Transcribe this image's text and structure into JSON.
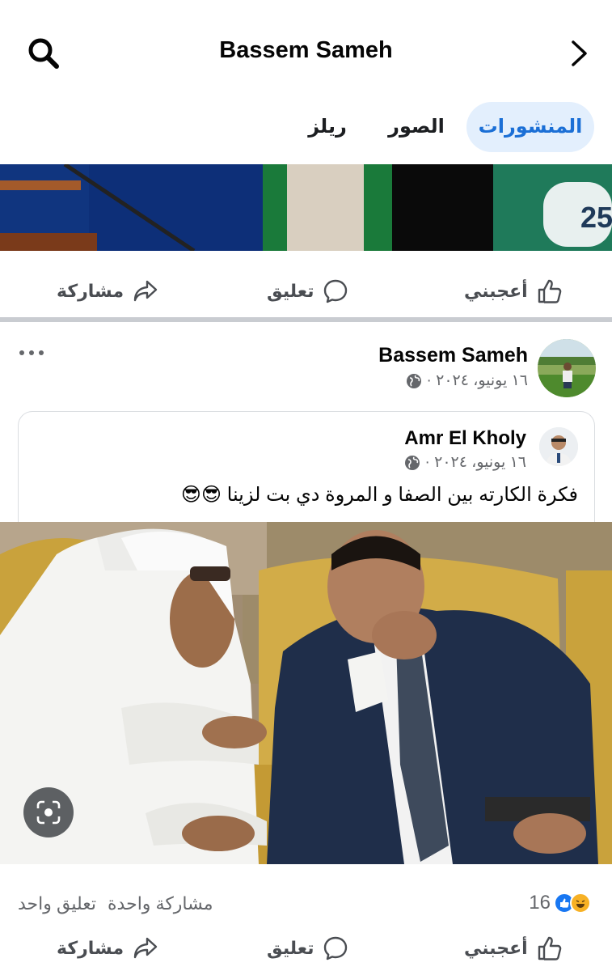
{
  "header": {
    "title": "Bassem Sameh",
    "search_icon": "search-icon",
    "back_icon": "chevron-right-icon"
  },
  "tabs": [
    {
      "label": "المنشورات",
      "active": true
    },
    {
      "label": "الصور",
      "active": false
    },
    {
      "label": "ريلز",
      "active": false
    }
  ],
  "actions": {
    "like": "أعجبني",
    "comment": "تعليق",
    "share": "مشاركة"
  },
  "post": {
    "author": "Bassem Sameh",
    "date": "١٦ يونيو، ٢٠٢٤ ·",
    "privacy_icon": "globe-icon",
    "shared": {
      "author": "Amr El Kholy",
      "date": "١٦ يونيو، ٢٠٢٤ ·",
      "text": "فكرة الكارته بين الصفا و المروة دي بت لزينا 😎😎"
    },
    "reaction_count": "16",
    "comments_count": "تعليق واحد",
    "shares_count": "مشاركة واحدة"
  },
  "colors": {
    "accent": "#1b6fd6",
    "tab_active_bg": "#e3effd",
    "muted": "#65676b"
  }
}
